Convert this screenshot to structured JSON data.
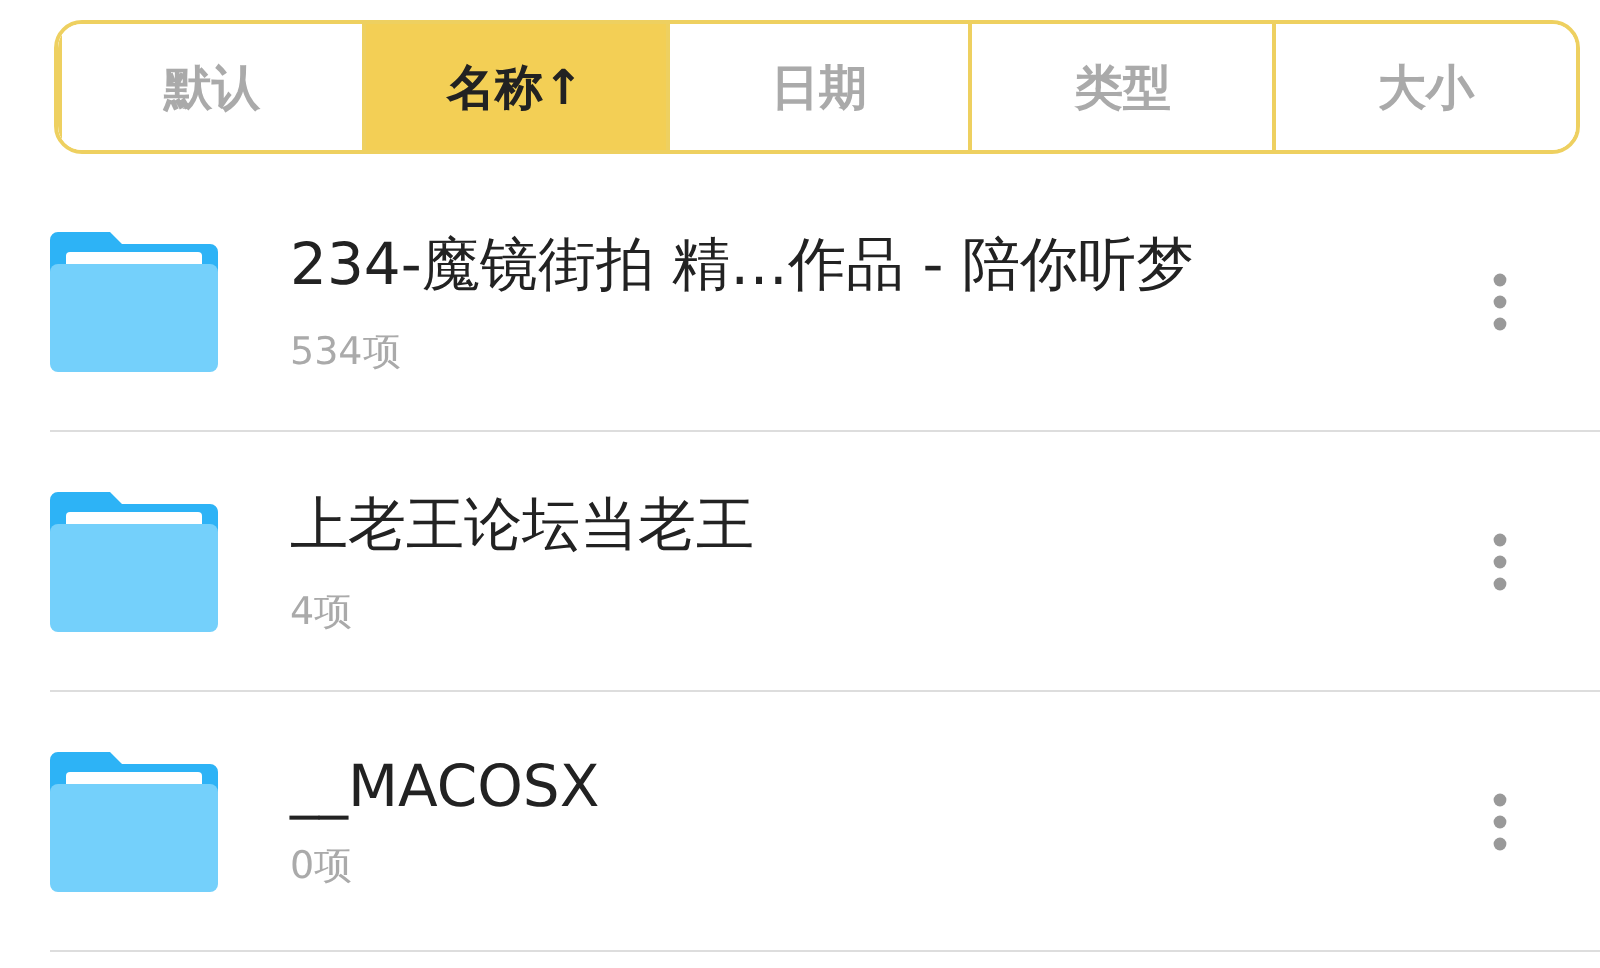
{
  "sort_tabs": [
    {
      "label": "默认",
      "selected": false
    },
    {
      "label": "名称↑",
      "selected": true
    },
    {
      "label": "日期",
      "selected": false
    },
    {
      "label": "类型",
      "selected": false
    },
    {
      "label": "大小",
      "selected": false
    }
  ],
  "files": [
    {
      "name": "234-魔镜街拍 精…作品 - 陪你听梦",
      "count": "534项"
    },
    {
      "name": "上老王论坛当老王",
      "count": "4项"
    },
    {
      "name": "__MACOSX",
      "count": "0项"
    }
  ]
}
